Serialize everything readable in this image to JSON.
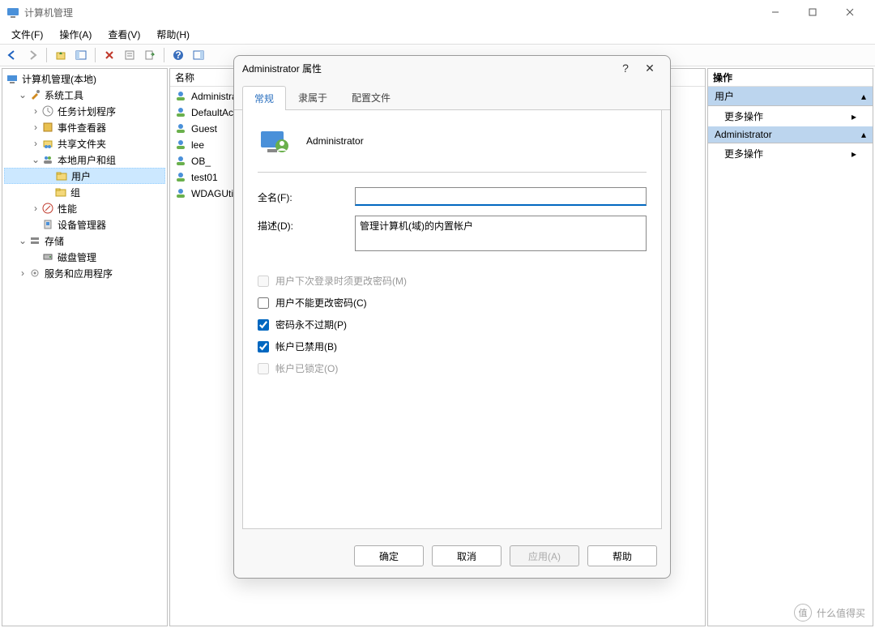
{
  "window": {
    "title": "计算机管理"
  },
  "menubar": {
    "file": "文件(F)",
    "action": "操作(A)",
    "view": "查看(V)",
    "help": "帮助(H)"
  },
  "tree": {
    "root": "计算机管理(本地)",
    "system_tools": "系统工具",
    "task_scheduler": "任务计划程序",
    "event_viewer": "事件查看器",
    "shared_folders": "共享文件夹",
    "local_users_groups": "本地用户和组",
    "users": "用户",
    "groups": "组",
    "performance": "性能",
    "device_manager": "设备管理器",
    "storage": "存储",
    "disk_management": "磁盘管理",
    "services_apps": "服务和应用程序"
  },
  "list": {
    "header_name": "名称",
    "items": [
      "Administrator",
      "DefaultAccount",
      "Guest",
      "lee",
      "OB_",
      "test01",
      "WDAGUtilityAccount"
    ]
  },
  "actions": {
    "header": "操作",
    "section1": "用户",
    "section2": "Administrator",
    "more": "更多操作"
  },
  "dialog": {
    "title": "Administrator 属性",
    "tabs": {
      "general": "常规",
      "member_of": "隶属于",
      "profile": "配置文件"
    },
    "user_name": "Administrator",
    "fullname_label": "全名(F):",
    "fullname_value": "",
    "description_label": "描述(D):",
    "description_value": "管理计算机(域)的内置帐户",
    "check_must_change": "用户下次登录时须更改密码(M)",
    "check_cannot_change": "用户不能更改密码(C)",
    "check_never_expires": "密码永不过期(P)",
    "check_disabled": "帐户已禁用(B)",
    "check_locked": "帐户已锁定(O)",
    "buttons": {
      "ok": "确定",
      "cancel": "取消",
      "apply": "应用(A)",
      "help": "帮助"
    }
  },
  "watermark": "什么值得买"
}
